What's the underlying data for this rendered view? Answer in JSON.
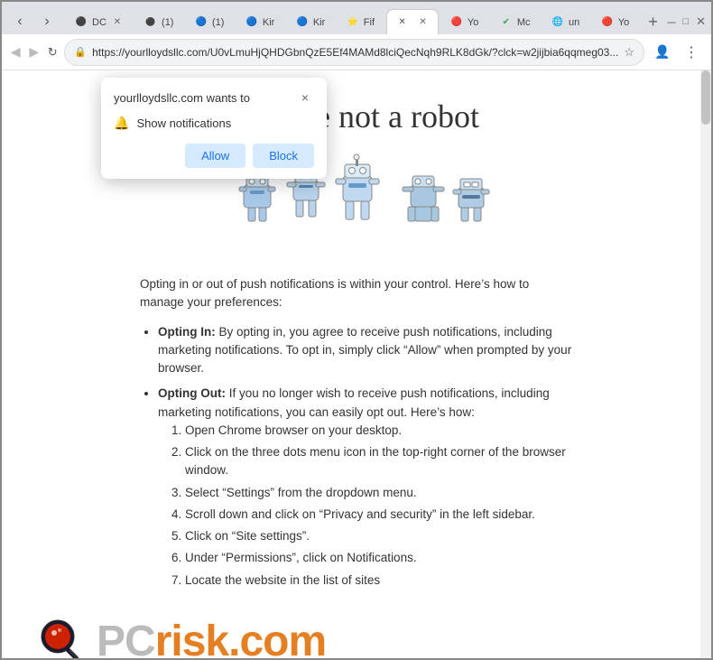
{
  "browser": {
    "tabs": [
      {
        "id": "tab1",
        "label": "DC",
        "icon": "🔵",
        "active": false
      },
      {
        "id": "tab2",
        "label": "(1)",
        "icon": "⚫",
        "active": false
      },
      {
        "id": "tab3",
        "label": "(1)",
        "icon": "🔵",
        "active": false
      },
      {
        "id": "tab4",
        "label": "Kir",
        "icon": "🔵",
        "active": false
      },
      {
        "id": "tab5",
        "label": "Kir",
        "icon": "🔵",
        "active": false
      },
      {
        "id": "tab6",
        "label": "Fif",
        "icon": "⭐",
        "active": false
      },
      {
        "id": "tab7",
        "label": "",
        "icon": "✕",
        "active": true
      },
      {
        "id": "tab8",
        "label": "Yo",
        "icon": "🔴",
        "active": false
      },
      {
        "id": "tab9",
        "label": "Mc",
        "icon": "✔",
        "active": false
      },
      {
        "id": "tab10",
        "label": "un",
        "icon": "🌐",
        "active": false
      },
      {
        "id": "tab11",
        "label": "Yo",
        "icon": "🔴",
        "active": false
      }
    ],
    "address": "https://yourlloydsllc.com/U0vLmuHjQHDGbnQzE5Ef4MAMd8lciQecNqh9RLK8dGk/?clck=w2jijbia6qqmeg03...",
    "address_short": "https://yourlloydsllc.com/U0vLmuHjQHDGbnQzE5Ef4MAMd8lciQecNqh9RLK8dGk/?clck=w2jijbia6qqmeg03..."
  },
  "notification_popup": {
    "title": "yourlloydsllc.com wants to",
    "close_label": "×",
    "notification_text": "Show notifications",
    "allow_label": "Allow",
    "block_label": "Block"
  },
  "page": {
    "hero_text": "you are not   a robot",
    "body_intro": "Opting in or out of push notifications is within your control. Here’s how to manage your preferences:",
    "bullet1_bold": "Opting In:",
    "bullet1_text": " By opting in, you agree to receive push notifications, including marketing notifications. To opt in, simply click “Allow” when prompted by your browser.",
    "bullet2_bold": "Opting Out:",
    "bullet2_text": " If you no longer wish to receive push notifications, including marketing notifications, you can easily opt out. Here’s how:",
    "steps": [
      "Open Chrome browser on your desktop.",
      "Click on the three dots menu icon in the top-right corner of the browser window.",
      "Select “Settings” from the dropdown menu.",
      "Scroll down and click on “Privacy and security” in the left sidebar.",
      "Click on “Site settings”.",
      "Under “Permissions”, click on Notifications.",
      "Locate the website in the list of sites"
    ]
  },
  "logo": {
    "pc_text": "PC",
    "risk_text": "risk",
    "om_text": "om"
  }
}
